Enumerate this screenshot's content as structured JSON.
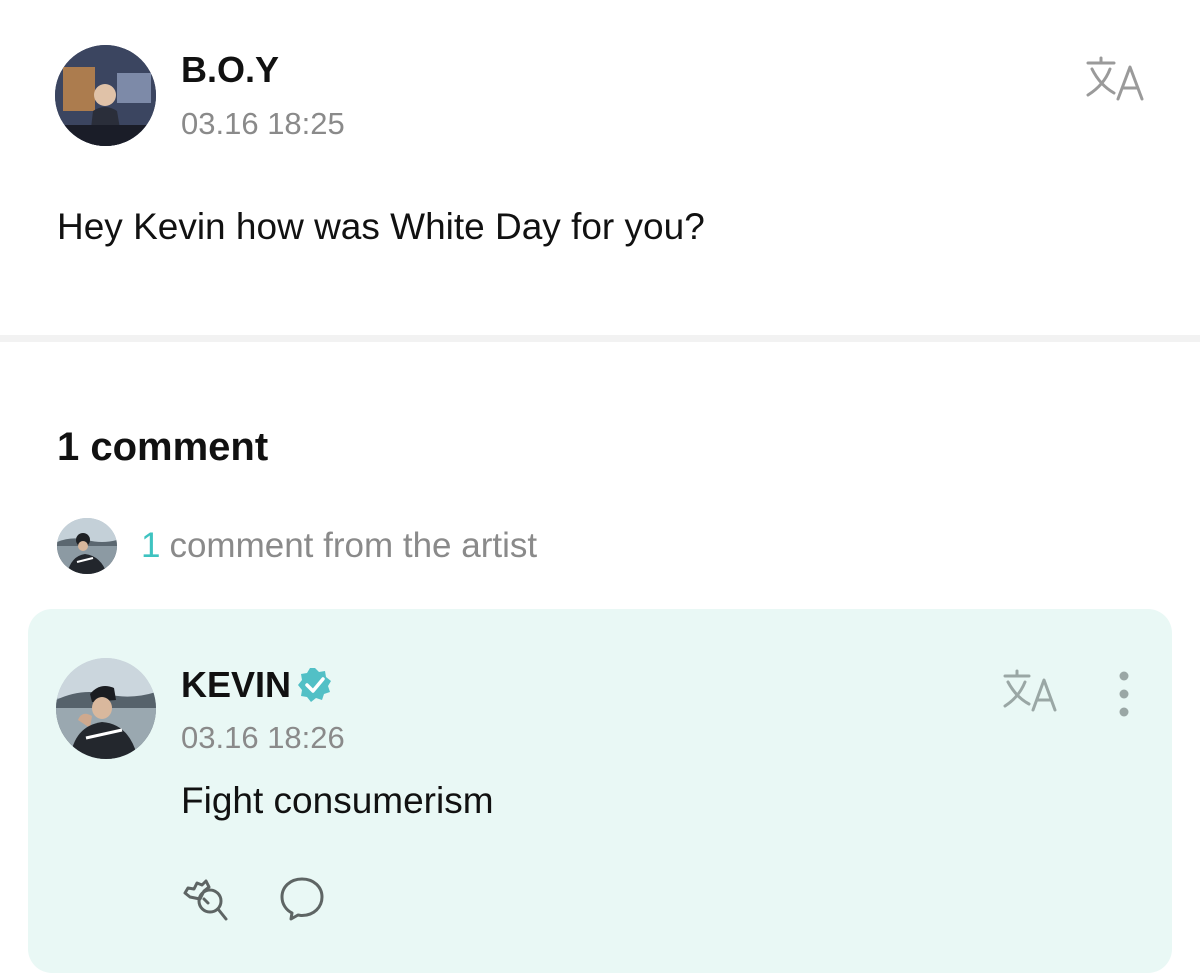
{
  "post": {
    "author": "B.O.Y",
    "time": "03.16 18:25",
    "body": "Hey Kevin how was White Day for you?",
    "translate_icon": "translate-icon"
  },
  "comments": {
    "count_label": "1 comment",
    "artist_summary": {
      "count": "1",
      "text": "comment from the artist"
    },
    "items": [
      {
        "author": "KEVIN",
        "verified": true,
        "time": "03.16 18:26",
        "body": "Fight consumerism",
        "icons": [
          "translate-icon",
          "more-vertical-icon",
          "like-icon",
          "reply-icon"
        ]
      }
    ]
  },
  "colors": {
    "accent": "#3ec3c0",
    "card_background": "#e9f8f5",
    "muted_text": "#8a8a8a",
    "verified_badge": "#52c0c6"
  }
}
